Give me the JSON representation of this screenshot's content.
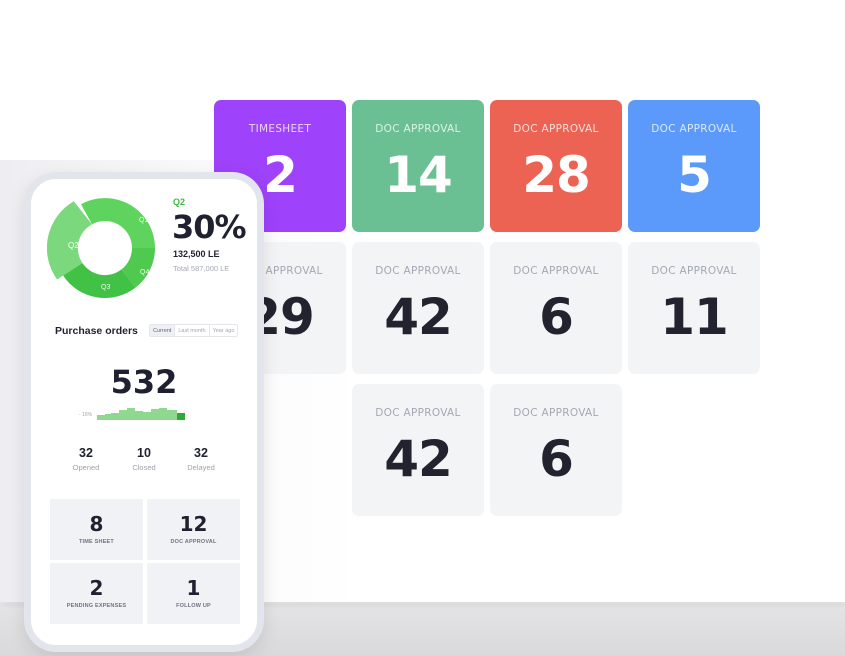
{
  "tiles": [
    {
      "label": "TIMESHEET",
      "value": "2",
      "color": "#9f42fb"
    },
    {
      "label": "DOC APPROVAL",
      "value": "14",
      "color": "#6ac092"
    },
    {
      "label": "DOC APPROVAL",
      "value": "28",
      "color": "#ec6353"
    },
    {
      "label": "DOC APPROVAL",
      "value": "5",
      "color": "#5b9afb"
    },
    {
      "label": "DOC APPROVAL",
      "value": "29"
    },
    {
      "label": "DOC APPROVAL",
      "value": "42"
    },
    {
      "label": "DOC APPROVAL",
      "value": "6"
    },
    {
      "label": "DOC APPROVAL",
      "value": "11"
    },
    {
      "label": "DOC APPROVAL",
      "value": "42"
    },
    {
      "label": "DOC APPROVAL",
      "value": "6"
    }
  ],
  "phone": {
    "donut": {
      "segments": [
        {
          "label": "Q1",
          "color": "#5ed45e"
        },
        {
          "label": "Q2",
          "color": "#7cd87c"
        },
        {
          "label": "Q3",
          "color": "#41c146"
        },
        {
          "label": "Q4",
          "color": "#4fca4f"
        }
      ],
      "selected": "Q2"
    },
    "quarter": "Q2",
    "percent": "30%",
    "amount": "132,500 LE",
    "total": "Total 587,000 LE",
    "purchase_orders": {
      "title": "Purchase orders",
      "tabs": [
        "Current",
        "Last month",
        "Year ago"
      ],
      "active_tab": "Current",
      "value": "532",
      "trend": "- 16%",
      "stats": [
        {
          "value": "32",
          "label": "Opened"
        },
        {
          "value": "10",
          "label": "Closed"
        },
        {
          "value": "32",
          "label": "Delayed"
        }
      ]
    },
    "mini_tiles": [
      {
        "value": "8",
        "label": "TIME SHEET"
      },
      {
        "value": "12",
        "label": "DOC APPROVAL"
      },
      {
        "value": "2",
        "label": "PENDING EXPENSES"
      },
      {
        "value": "1",
        "label": "FOLLOW UP"
      }
    ]
  }
}
